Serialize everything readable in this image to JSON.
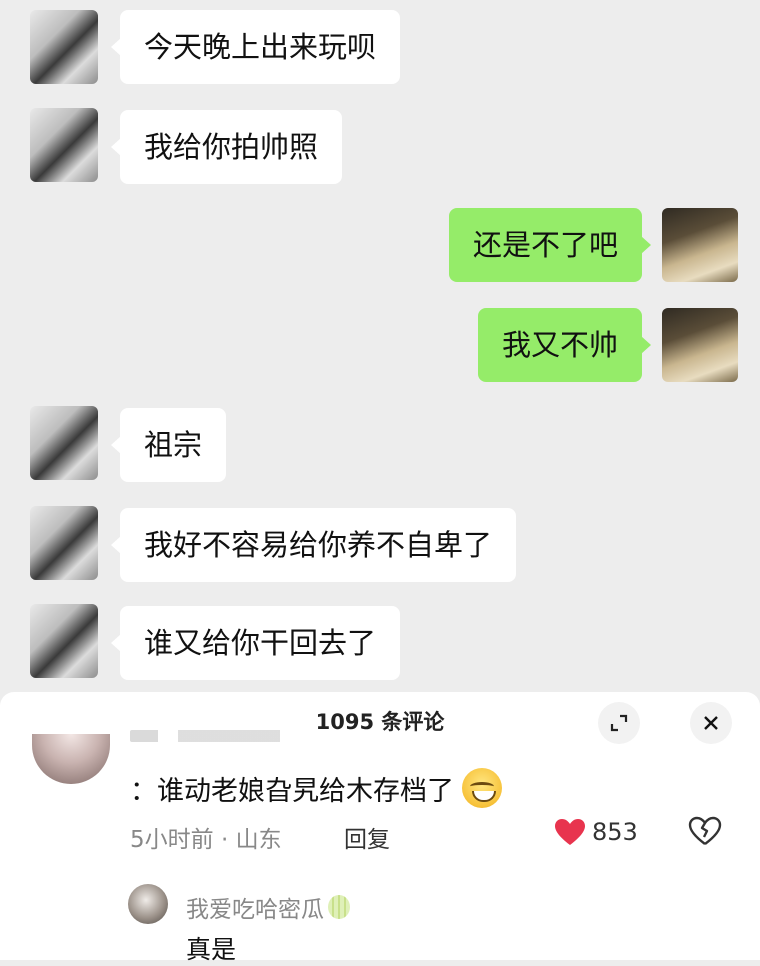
{
  "chat": {
    "messages": [
      {
        "side": "left",
        "text": "今天晚上出来玩呗"
      },
      {
        "side": "left",
        "text": "我给你拍帅照"
      },
      {
        "side": "right",
        "text": "还是不了吧"
      },
      {
        "side": "right",
        "text": "我又不帅"
      },
      {
        "side": "left",
        "text": "祖宗"
      },
      {
        "side": "left",
        "text": "我好不容易给你养不自卑了"
      },
      {
        "side": "left",
        "text": "谁又给你干回去了"
      }
    ]
  },
  "comments": {
    "title": "1095 条评论",
    "expand_icon": "expand-icon",
    "close_icon": "close-icon",
    "top_comment": {
      "text": "：谁动老娘旮旯给木存档了",
      "emoji": "grinning-sweat-emoji",
      "time_location": "5小时前 · 山东",
      "reply_label": "回复",
      "like_count": "853",
      "like_color": "#e8344e"
    },
    "reply": {
      "username": "我爱吃哈密瓜",
      "badge": "melon-icon",
      "text": "真是"
    }
  },
  "colors": {
    "chat_background": "#ededed",
    "incoming_bubble": "#ffffff",
    "outgoing_bubble": "#95ec69"
  }
}
